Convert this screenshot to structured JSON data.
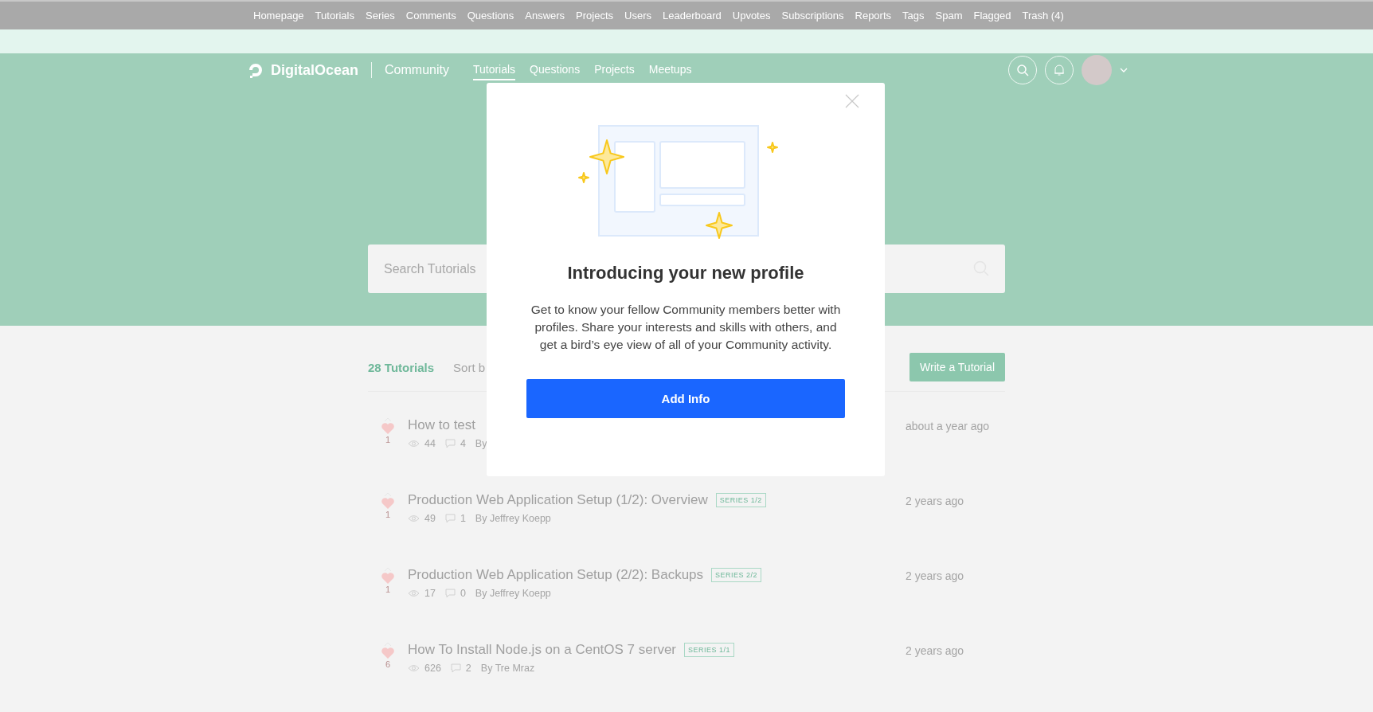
{
  "admin_nav": [
    "Homepage",
    "Tutorials",
    "Series",
    "Comments",
    "Questions",
    "Answers",
    "Projects",
    "Users",
    "Leaderboard",
    "Upvotes",
    "Subscriptions",
    "Reports",
    "Tags",
    "Spam",
    "Flagged",
    "Trash (4)"
  ],
  "header": {
    "logo": "DigitalOcean",
    "section": "Community",
    "nav": [
      {
        "label": "Tutorials",
        "selected": true
      },
      {
        "label": "Questions",
        "selected": false
      },
      {
        "label": "Projects",
        "selected": false
      },
      {
        "label": "Meetups",
        "selected": false
      }
    ]
  },
  "search": {
    "placeholder": "Search Tutorials"
  },
  "list_header": {
    "count": "28 Tutorials",
    "sort": "Sort b",
    "write_button": "Write a Tutorial"
  },
  "tutorials": [
    {
      "votes": "1",
      "title": "How to test",
      "views": "44",
      "comments": "4",
      "author": "By",
      "time": "about a year ago"
    },
    {
      "votes": "1",
      "title": "Production Web Application Setup (1/2): Overview",
      "series": "SERIES 1/2",
      "views": "49",
      "comments": "1",
      "author": "By Jeffrey Koepp",
      "time": "2 years ago"
    },
    {
      "votes": "1",
      "title": "Production Web Application Setup (2/2): Backups",
      "series": "SERIES 2/2",
      "views": "17",
      "comments": "0",
      "author": "By Jeffrey Koepp",
      "time": "2 years ago"
    },
    {
      "votes": "6",
      "title": "How To Install Node.js on a CentOS 7 server",
      "series": "SERIES 1/1",
      "views": "626",
      "comments": "2",
      "author": "By Tre Mraz",
      "time": "2 years ago"
    }
  ],
  "modal": {
    "title": "Introducing your new profile",
    "body": "Get to know your fellow Community members better with profiles. Share your interests and skills with others, and get a bird’s eye view of all of your Community activity.",
    "button": "Add Info"
  }
}
